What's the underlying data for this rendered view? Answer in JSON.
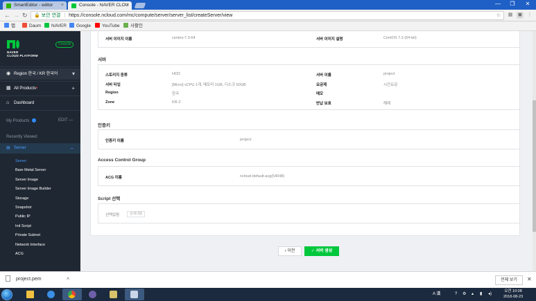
{
  "browser": {
    "tabs": [
      {
        "title": "SmartEditor - editor",
        "active": false
      },
      {
        "title": "Console - NAVER CLOU",
        "active": true
      }
    ],
    "window_controls": [
      "—",
      "❐",
      "✕"
    ],
    "address": {
      "secure_label": "보안 연결",
      "url": "https://console.ncloud.com/mc/compute/server/server_list/createServer/view"
    },
    "bookmarks": [
      {
        "label": "앱",
        "color": "#4285f4"
      },
      {
        "label": "Daum",
        "color": "#f04d3a"
      },
      {
        "label": "NAVER",
        "color": "#00c73c"
      },
      {
        "label": "Google",
        "color": "#4285f4"
      },
      {
        "label": "YouTube",
        "color": "#ff0000"
      },
      {
        "label": "사활인",
        "color": "#6ab04c"
      }
    ]
  },
  "sidebar": {
    "brand_line1": "NAVER",
    "brand_line2": "CLOUD PLATFORM",
    "console_badge": "Console",
    "region": "Region 한국 / KR 한국어",
    "all_products": "All Products",
    "dashboard": "Dashboard",
    "my_products": "My Products",
    "edit": "EDIT",
    "recently_viewed": "Recently Viewed",
    "server_section": "Server",
    "submenu": [
      "Server",
      "Bare Metal Server",
      "Server Image",
      "Server Image Builder",
      "Storage",
      "Snapshot",
      "Public IP",
      "Init Script",
      "Private Subnet",
      "Network Interface",
      "ACG"
    ]
  },
  "main": {
    "image_row": {
      "name_label": "서버 이미지 이름",
      "name_value": "centos-7.3-64",
      "desc_label": "서버 이미지 설명",
      "desc_value": "CentOS 7.3 (64-bit)"
    },
    "server_section": {
      "title": "서버",
      "rows": [
        {
          "label": "스토리지 종류",
          "value": "HDD",
          "label2": "서버 이름",
          "value2": "project"
        },
        {
          "label": "서버 타입",
          "value": "[Micro] vCPU 1개, 메모리 1GB, 디스크 50GB",
          "label2": "요금제",
          "value2": "시간요금"
        },
        {
          "label": "Region",
          "value": "한국",
          "label2": "메모",
          "value2": ""
        },
        {
          "label": "Zone",
          "value": "KR-2",
          "label2": "반납 보호",
          "value2": "해제"
        }
      ]
    },
    "auth_section": {
      "title": "인증키",
      "label": "인증키 이름",
      "value": "project"
    },
    "acg_section": {
      "title": "Access Control Group",
      "label": "ACG 이름",
      "value": "ncloud-default-acg(54048)"
    },
    "script_section": {
      "title": "Script 선택",
      "label": "선택없음",
      "chip": "상세내용"
    },
    "buttons": {
      "prev": "이전",
      "create": "서버 생성"
    }
  },
  "downloads": {
    "file": "project.pem",
    "show_all": "전체 보기"
  },
  "taskbar": {
    "ime": "A 漢",
    "time": "오전 10:08",
    "date": "2018-08-23"
  }
}
